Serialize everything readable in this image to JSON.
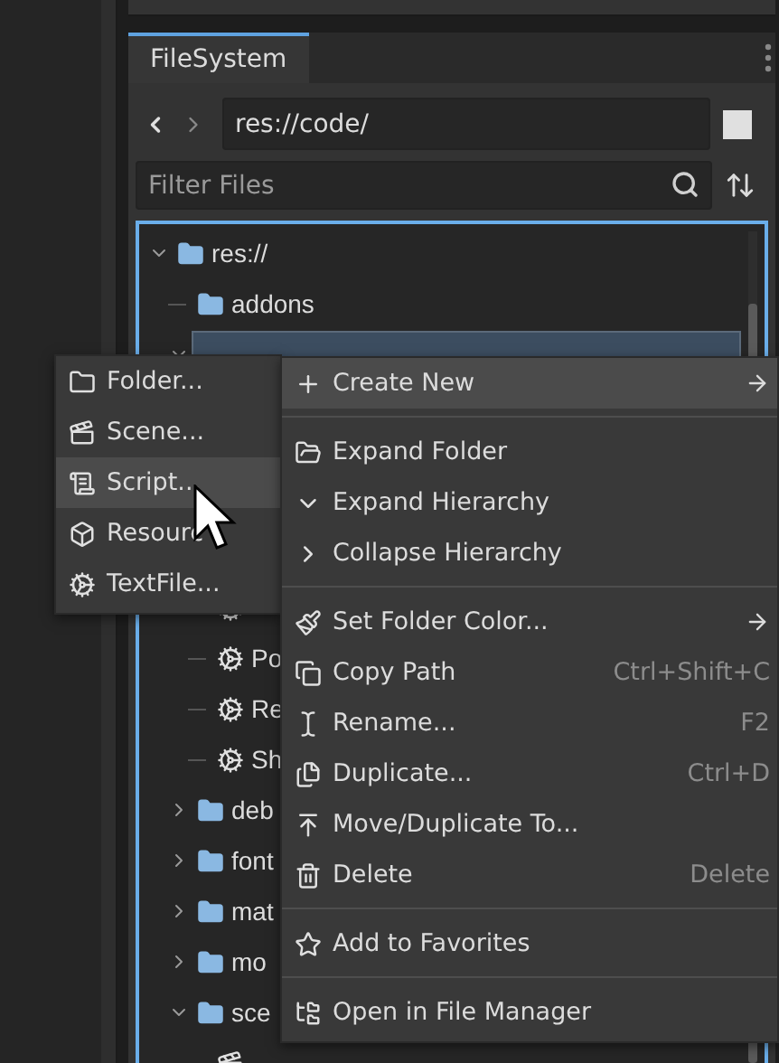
{
  "dock": {
    "tab": {
      "label": "FileSystem",
      "selected": true
    },
    "path": "res://code/",
    "filter": {
      "placeholder": "Filter Files"
    }
  },
  "tree": [
    {
      "label": "res://",
      "kind": "folder",
      "expanded": true,
      "children": [
        {
          "label": "addons",
          "kind": "folder"
        },
        {
          "selected": true,
          "expanded": true,
          "children": [
            {
              "kind": "script"
            },
            {
              "label": "Po",
              "kind": "script"
            },
            {
              "label": "Re",
              "kind": "script"
            },
            {
              "label": "Sh",
              "kind": "script"
            }
          ]
        },
        {
          "label": "deb",
          "kind": "folder",
          "expanded": false
        },
        {
          "label": "font",
          "kind": "folder",
          "expanded": false
        },
        {
          "label": "mat",
          "kind": "folder",
          "expanded": false
        },
        {
          "label": "mo",
          "kind": "folder",
          "expanded": false
        },
        {
          "label": "sce",
          "kind": "folder",
          "expanded": true,
          "children": [
            {
              "kind": "scene"
            }
          ]
        }
      ]
    }
  ],
  "submenu": [
    {
      "label": "Folder...",
      "selected": false
    },
    {
      "label": "Scene...",
      "selected": false
    },
    {
      "label": "Script...",
      "selected": true
    },
    {
      "label": "Resourc",
      "selected": false
    },
    {
      "label": "TextFile...",
      "selected": false
    }
  ],
  "context_menu": [
    {
      "kind": "item",
      "label": "Create New",
      "submenu": true,
      "selected": true
    },
    {
      "kind": "separator"
    },
    {
      "kind": "item",
      "label": "Expand Folder",
      "selected": false
    },
    {
      "kind": "item",
      "label": "Expand Hierarchy",
      "selected": false
    },
    {
      "kind": "item",
      "label": "Collapse Hierarchy",
      "selected": false
    },
    {
      "kind": "separator"
    },
    {
      "kind": "item",
      "label": "Set Folder Color...",
      "submenu": true,
      "selected": false
    },
    {
      "kind": "item",
      "label": "Copy Path",
      "shortcut": "Ctrl+Shift+C",
      "selected": false
    },
    {
      "kind": "item",
      "label": "Rename...",
      "shortcut": "F2",
      "selected": false
    },
    {
      "kind": "item",
      "label": "Duplicate...",
      "shortcut": "Ctrl+D",
      "selected": false
    },
    {
      "kind": "item",
      "label": "Move/Duplicate To...",
      "selected": false
    },
    {
      "kind": "item",
      "label": "Delete",
      "shortcut": "Delete",
      "selected": false
    },
    {
      "kind": "separator"
    },
    {
      "kind": "item",
      "label": "Add to Favorites",
      "selected": false
    },
    {
      "kind": "separator"
    },
    {
      "kind": "item",
      "label": "Open in File Manager",
      "selected": false
    }
  ]
}
